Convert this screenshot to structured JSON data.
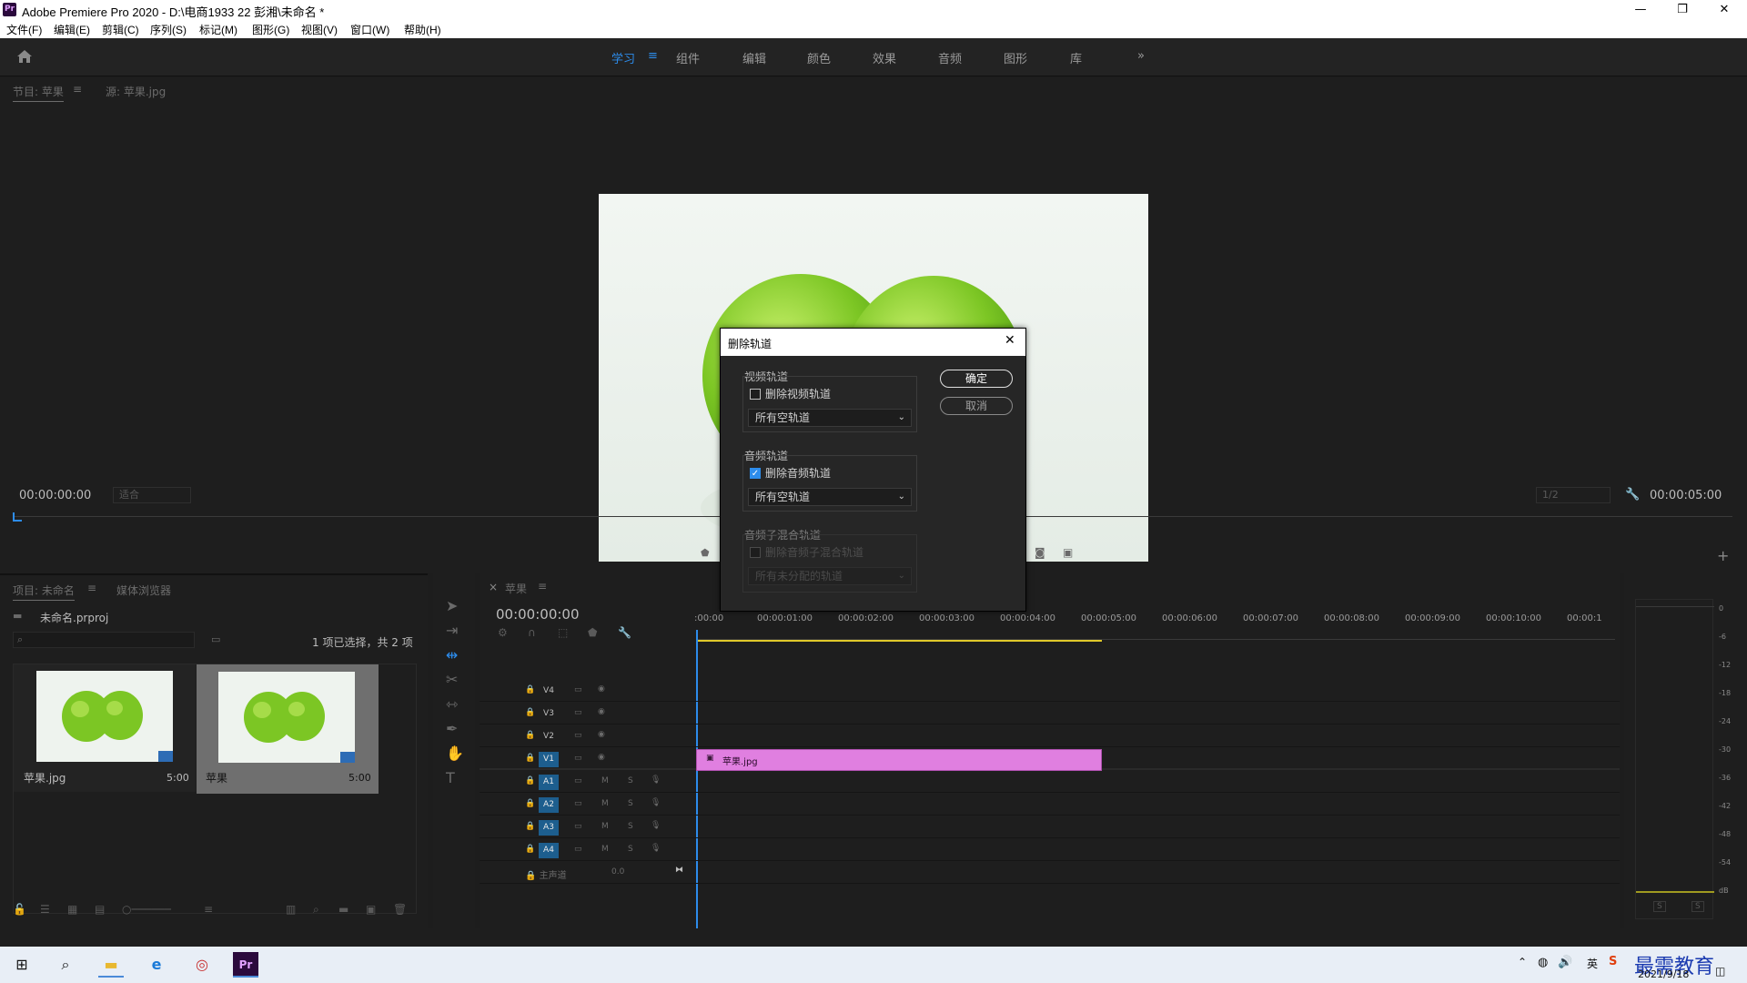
{
  "window": {
    "title": "Adobe Premiere Pro 2020 - D:\\电商1933 22 彭湘\\未命名 *",
    "logo_text": "Pr",
    "minimize": "—",
    "maximize": "❐",
    "close": "✕"
  },
  "menu": [
    "文件(F)",
    "编辑(E)",
    "剪辑(C)",
    "序列(S)",
    "标记(M)",
    "图形(G)",
    "视图(V)",
    "窗口(W)",
    "帮助(H)"
  ],
  "workspaces": {
    "items": [
      "学习",
      "组件",
      "编辑",
      "颜色",
      "效果",
      "音频",
      "图形",
      "库"
    ],
    "active": "学习",
    "more": "»"
  },
  "program_monitor": {
    "tab_project": "节目: 苹果",
    "tab_source": "源: 苹果.jpg",
    "timecode_left": "00:00:00:00",
    "fit": "适合",
    "resolution": "1/2",
    "timecode_right": "00:00:05:00"
  },
  "project_panel": {
    "tab_project": "项目: 未命名",
    "tab_media": "媒体浏览器",
    "project_file": "未命名.prproj",
    "selection_info": "1 项已选择，共 2 项",
    "items": [
      {
        "name": "苹果.jpg",
        "duration": "5:00"
      },
      {
        "name": "苹果",
        "duration": "5:00"
      }
    ]
  },
  "timeline": {
    "tab": "苹果",
    "close": "×",
    "timecode": "00:00:00:00",
    "ruler": [
      ":00:00",
      "00:00:01:00",
      "00:00:02:00",
      "00:00:03:00",
      "00:00:04:00",
      "00:00:05:00",
      "00:00:06:00",
      "00:00:07:00",
      "00:00:08:00",
      "00:00:09:00",
      "00:00:10:00",
      "00:00:1"
    ],
    "video_tracks": [
      "V4",
      "V3",
      "V2",
      "V1"
    ],
    "audio_tracks": [
      "A1",
      "A2",
      "A3",
      "A4"
    ],
    "master_label": "主声道",
    "master_value": "0.0",
    "clip_name": "苹果.jpg",
    "mute": "M",
    "solo": "S"
  },
  "audio_meter": {
    "scale": [
      "0",
      "-6",
      "-12",
      "-18",
      "-24",
      "-30",
      "-36",
      "-42",
      "-48",
      "-54",
      "dB"
    ],
    "solo_left": "S",
    "solo_right": "S"
  },
  "dialog": {
    "title": "删除轨道",
    "close": "✕",
    "ok": "确定",
    "cancel": "取消",
    "video": {
      "group_label": "视频轨道",
      "checkbox_label": "删除视频轨道",
      "checked": false,
      "select_value": "所有空轨道"
    },
    "audio": {
      "group_label": "音频轨道",
      "checkbox_label": "删除音频轨道",
      "checked": true,
      "select_value": "所有空轨道"
    },
    "submix": {
      "group_label": "音频子混合轨道",
      "checkbox_label": "删除音频子混合轨道",
      "checked": false,
      "select_value": "所有未分配的轨道"
    }
  },
  "taskbar": {
    "date": "2021/9/18",
    "ime": "英",
    "watermark": "最需教育"
  },
  "colors": {
    "accent": "#2d8ceb",
    "clip": "#e07fe0",
    "panel": "#1e1e1e"
  }
}
